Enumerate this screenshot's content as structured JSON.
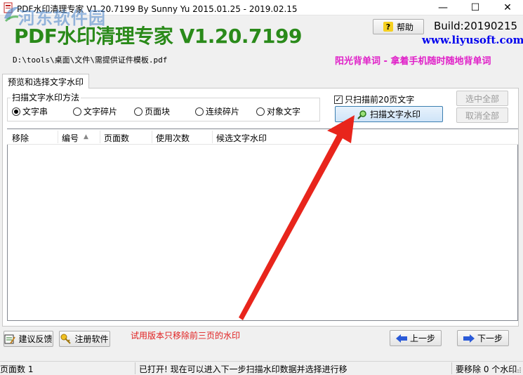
{
  "window": {
    "title": "PDF水印清理专家 V1.20.7199 By Sunny Yu 2015.01.25 - 2019.02.15",
    "minimize_glyph": "—",
    "maximize_glyph": "☐",
    "close_glyph": "✕"
  },
  "watermark": {
    "text": "河东软件园"
  },
  "header": {
    "app_title": "PDF水印清理专家 V1.20.7199",
    "help_label": "帮助",
    "help_icon": "?",
    "build": "Build:20190215",
    "website": "www.liyusoft.com",
    "file_path": "D:\\tools\\桌面\\文件\\需提供证件模板.pdf",
    "ad_text": "阳光背单词 - 拿着手机随时随地背单词"
  },
  "tabs": [
    {
      "label": "预览和选择文字水印",
      "active": true
    }
  ],
  "scan_method": {
    "legend": "扫描文字水印方法",
    "options": [
      {
        "label": "文字串",
        "selected": true
      },
      {
        "label": "文字碎片",
        "selected": false
      },
      {
        "label": "页面块",
        "selected": false
      },
      {
        "label": "连续碎片",
        "selected": false
      },
      {
        "label": "对象文字",
        "selected": false
      }
    ]
  },
  "options": {
    "first20_label": "只扫描前20页文字",
    "first20_checked": true,
    "scan_button": "扫描文字水印",
    "select_all": "选中全部",
    "deselect_all": "取消全部"
  },
  "list": {
    "columns": [
      "移除",
      "编号",
      "页面数",
      "使用次数",
      "候选文字水印"
    ],
    "rows": []
  },
  "footer": {
    "feedback_button": "建议反馈",
    "register_button": "注册软件",
    "trial_note": "试用版本只移除前三页的水印",
    "prev_button": "上一步",
    "next_button": "下一步"
  },
  "statusbar": {
    "page_count": "页面数 1",
    "message": "已打开! 现在可以进入下一步扫描水印数据并选择进行移",
    "remove_count": "要移除 0 个水印"
  },
  "colors": {
    "title_green": "#2a8a1a",
    "website_blue": "#0000ee",
    "ad_magenta": "#e020c8",
    "note_red": "#e02020",
    "arrow_red": "#e8251c"
  }
}
